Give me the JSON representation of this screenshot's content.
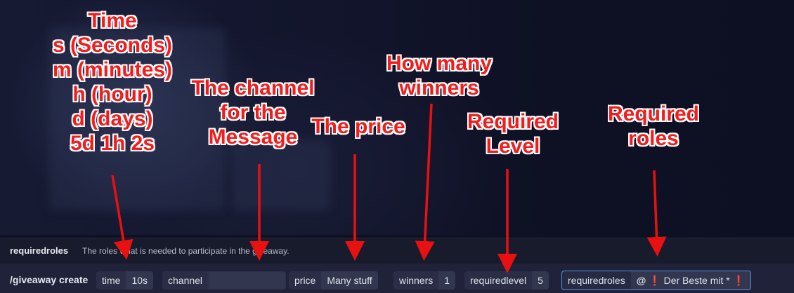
{
  "hint": {
    "option_name": "requiredroles",
    "option_desc": "The roles what is needed to participate in the giveaway."
  },
  "command": {
    "name": "/giveaway create",
    "options": [
      {
        "key": "time",
        "value": "10s"
      },
      {
        "key": "channel",
        "value": ""
      },
      {
        "key": "price",
        "value": "Many stuff"
      },
      {
        "key": "winners",
        "value": "1"
      },
      {
        "key": "requiredlevel",
        "value": "5"
      },
      {
        "key": "requiredroles",
        "value_prefix": "@",
        "role_name": "Der Beste mit *"
      }
    ]
  },
  "annotations": {
    "time": [
      "Time",
      "s (Seconds)",
      "m (minutes)",
      "h (hour)",
      "d (days)",
      "5d 1h 2s"
    ],
    "channel": [
      "The channel",
      "for the",
      "Message"
    ],
    "price": [
      "The price"
    ],
    "winners": [
      "How many",
      "winners"
    ],
    "level": [
      "Required",
      "Level"
    ],
    "roles": [
      "Required",
      "roles"
    ]
  },
  "colors": {
    "annotation_text": "#f21c1c",
    "arrow": "#e81010",
    "active_border": "#5b8de8",
    "role_marker": "#e03838"
  }
}
